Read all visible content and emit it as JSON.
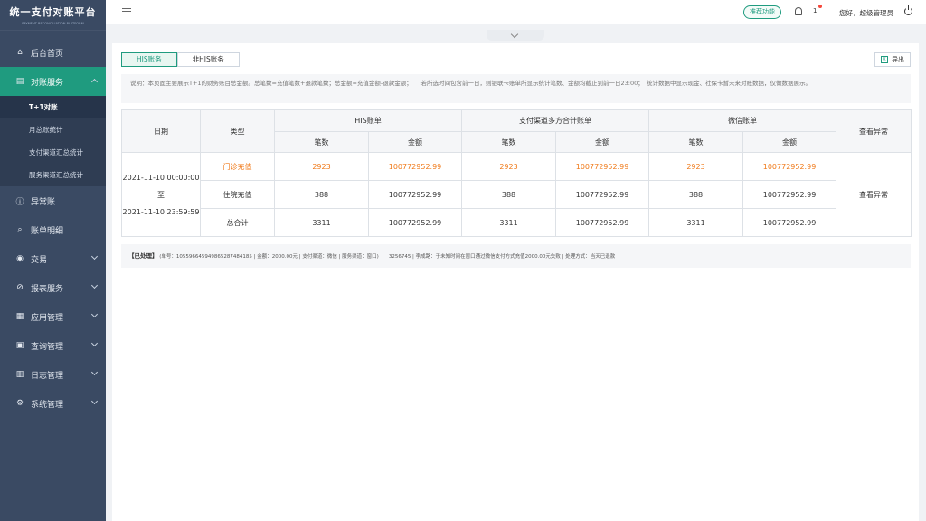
{
  "app": {
    "title": "统一支付对账平台",
    "subtitle": "PAYMENT RECONCILIATION PLATFORM"
  },
  "sidebar": {
    "items": [
      {
        "label": "后台首页",
        "icon": "home-icon"
      },
      {
        "label": "对账服务",
        "icon": "reconcile-icon",
        "active": true
      },
      {
        "label": "异常账",
        "icon": "alert-icon"
      },
      {
        "label": "账单明细",
        "icon": "search-icon"
      },
      {
        "label": "交易",
        "icon": "trade-icon"
      },
      {
        "label": "报表服务",
        "icon": "report-icon"
      },
      {
        "label": "应用管理",
        "icon": "apps-icon"
      },
      {
        "label": "查询管理",
        "icon": "query-icon"
      },
      {
        "label": "日志管理",
        "icon": "log-icon"
      },
      {
        "label": "系统管理",
        "icon": "settings-icon"
      }
    ],
    "sub_items": [
      "T+1对账",
      "月总账统计",
      "支付渠道汇总统计",
      "服务渠道汇总统计"
    ]
  },
  "header": {
    "recommend_label": "推荐功能",
    "notification_count": "1",
    "greeting": "您好，超级管理员"
  },
  "tabs": [
    "HIS账务",
    "非HIS账务"
  ],
  "export_label": "导出",
  "note": "说明：本页面主要展示T+1的财务账目总金额。总笔数=充值笔数+退款笔数；总金额=充值金额-退款金额；　　若所选时间包含前一日，则银联卡账单所显示统计笔数、金额均截止到前一日23:00；　统计数据中显示现金、社保卡暂未来对账数据，仅做数据展示。",
  "table": {
    "headers": {
      "date": "日期",
      "type": "类型",
      "his": "HIS账单",
      "channel": "支付渠道多方合计账单",
      "wechat": "微信账单",
      "view": "查看异常",
      "count": "笔数",
      "amount": "金额"
    },
    "date_from": "2021-11-10 00:00:00",
    "date_to_label": "至",
    "date_to": "2021-11-10 23:59:59",
    "view_link": "查看异常",
    "rows": [
      {
        "type": "门诊充值",
        "c1": "2923",
        "a1": "100772952.99",
        "c2": "2923",
        "a2": "100772952.99",
        "c3": "2923",
        "a3": "100772952.99"
      },
      {
        "type": "住院充值",
        "c1": "388",
        "a1": "100772952.99",
        "c2": "388",
        "a2": "100772952.99",
        "c3": "388",
        "a3": "100772952.99"
      },
      {
        "type": "总合计",
        "c1": "3311",
        "a1": "100772952.99",
        "c2": "3311",
        "a2": "100772952.99",
        "c3": "3311",
        "a3": "100772952.99"
      }
    ]
  },
  "processed": {
    "tag": "【已处理】",
    "text": "(单号：105596645949865287484185 | 金额：2000.00元 | 支付渠道：微信 | 服务渠道：窗口)　　3256745 | 李成路：于未知时间在窗口通过微信支付方式充值2000.00元失败 | 处理方式：当天已退款"
  },
  "colors": {
    "accent": "#1f9b7f",
    "sidebar": "#3a4a63",
    "highlight": "#f07a1a"
  }
}
